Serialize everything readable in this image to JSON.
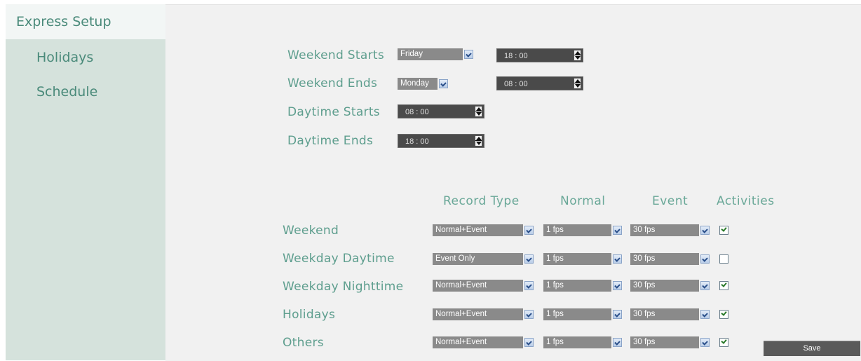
{
  "sidebar": {
    "items": [
      {
        "label": "Express Setup",
        "active": true
      },
      {
        "label": "Holidays",
        "active": false
      },
      {
        "label": "Schedule",
        "active": false
      }
    ]
  },
  "weekend": {
    "starts_label": "Weekend Starts",
    "starts_day": "Friday",
    "starts_time": "18 : 00",
    "ends_label": "Weekend Ends",
    "ends_day": "Monday",
    "ends_time": "08 : 00"
  },
  "daytime": {
    "starts_label": "Daytime Starts",
    "starts_time": "08 : 00",
    "ends_label": "Daytime Ends",
    "ends_time": "18 : 00"
  },
  "table": {
    "headers": [
      "Record Type",
      "Normal",
      "Event",
      "Activities"
    ],
    "rows": [
      {
        "label": "Weekend",
        "record_type": "Normal+Event",
        "normal": "1 fps",
        "event": "30 fps",
        "activities": true
      },
      {
        "label": "Weekday Daytime",
        "record_type": "Event Only",
        "normal": "1 fps",
        "event": "30 fps",
        "activities": false
      },
      {
        "label": "Weekday Nighttime",
        "record_type": "Normal+Event",
        "normal": "1 fps",
        "event": "30 fps",
        "activities": true
      },
      {
        "label": "Holidays",
        "record_type": "Normal+Event",
        "normal": "1 fps",
        "event": "30 fps",
        "activities": true
      },
      {
        "label": "Others",
        "record_type": "Normal+Event",
        "normal": "1 fps",
        "event": "30 fps",
        "activities": true
      }
    ]
  },
  "save_label": "Save",
  "colors": {
    "accent_text": "#5e9e8e",
    "sidebar_bg": "#d5e2dc",
    "control_bg": "#8a8a8a",
    "time_bg": "#4a4a4a"
  }
}
